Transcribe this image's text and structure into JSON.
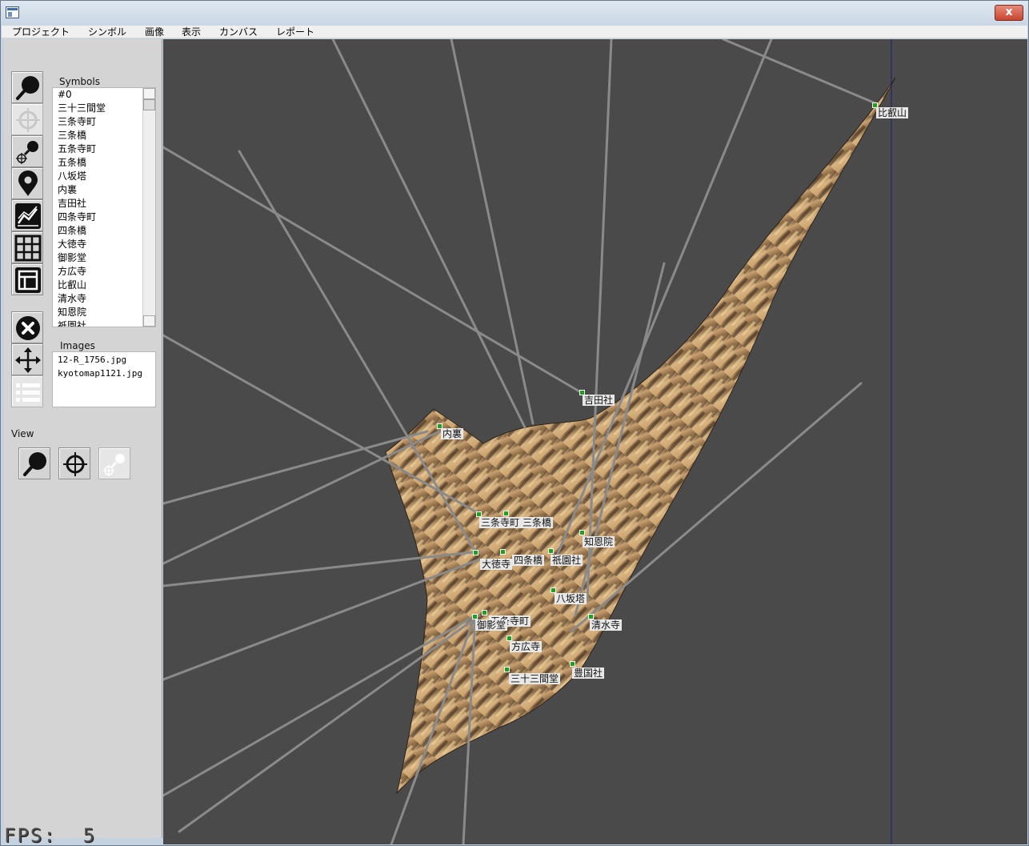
{
  "window": {
    "close_label": "x"
  },
  "menu": [
    "プロジェクト",
    "シンボル",
    "画像",
    "表示",
    "カンバス",
    "レポート"
  ],
  "tools": [
    "search-tool",
    "target-tool",
    "search-target-tool",
    "map-pin-tool",
    "chart-tool",
    "grid-tool",
    "layout-tool",
    "delete-tool",
    "move-tool",
    "list-tool"
  ],
  "symbols_panel": {
    "label": "Symbols",
    "items": [
      "#0",
      "三十三間堂",
      "三条寺町",
      "三条橋",
      "五条寺町",
      "五条橋",
      "八坂塔",
      "内裏",
      "吉田社",
      "四条寺町",
      "四条橋",
      "大徳寺",
      "御影堂",
      "方広寺",
      "比叡山",
      "清水寺",
      "知恩院",
      "祇園社"
    ]
  },
  "images_panel": {
    "label": "Images",
    "items": [
      "12-R_1756.jpg",
      "kyotomap1121.jpg"
    ]
  },
  "view_panel": {
    "label": "View"
  },
  "canvas_labels": {
    "hiei": "比叡山",
    "yoshida": "吉田社",
    "dairi": "内裏",
    "sanjo_teramachi": "三条寺町",
    "sanjo_bashi": "三条橋",
    "chionin": "知恩院",
    "daitokuji": "大徳寺",
    "shijo_bashi": "四条橋",
    "gion": "祇園社",
    "yasaka": "八坂塔",
    "gojo_teramachi": "五条寺町",
    "mieido": "御影堂",
    "kiyomizu": "清水寺",
    "hokoji": "方広寺",
    "toyokuni": "豊国社",
    "sanjusangendo": "三十三間堂"
  },
  "status": {
    "fps": "FPS:  5"
  },
  "colors": {
    "canvas_bg": "#4a4a4a",
    "marker": "#1fa01f",
    "ray": "#8a8a8a",
    "guide_line": "#1a1f7a"
  }
}
